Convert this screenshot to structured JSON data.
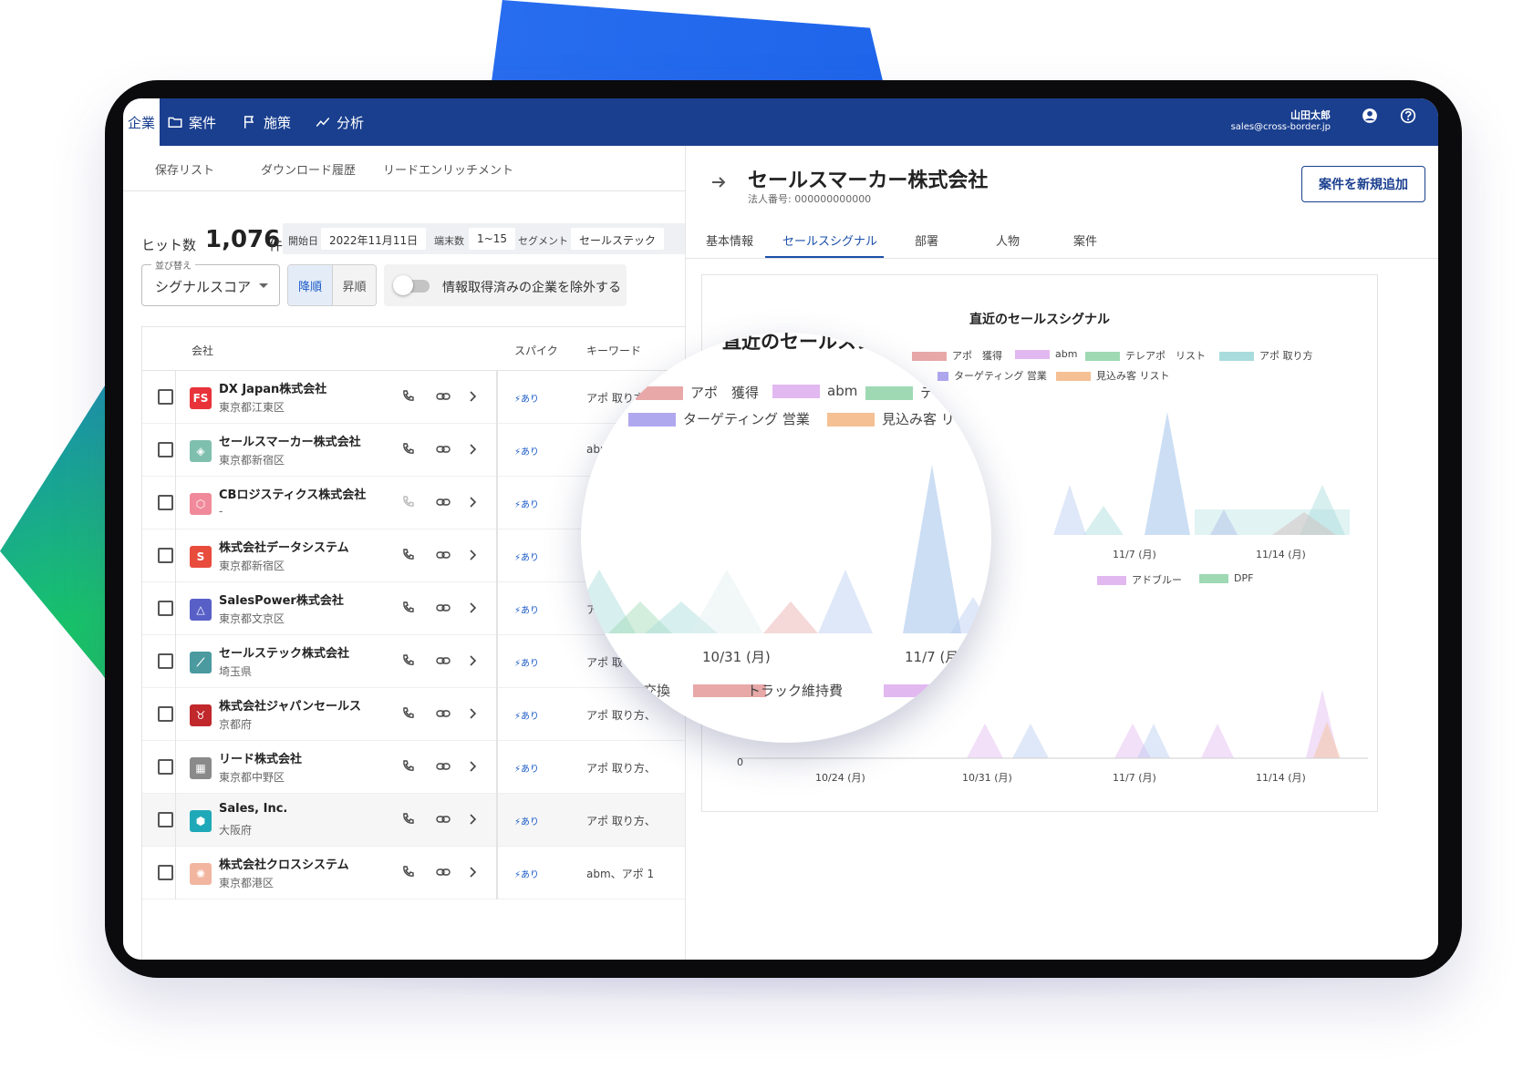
{
  "nav": {
    "items": [
      {
        "label": "企業",
        "icon": "building-icon",
        "active": true
      },
      {
        "label": "案件",
        "icon": "folder-icon",
        "active": false
      },
      {
        "label": "施策",
        "icon": "flag-icon",
        "active": false
      },
      {
        "label": "分析",
        "icon": "analytics-icon",
        "active": false
      }
    ],
    "user_name": "山田太郎",
    "user_email": "sales@cross-border.jp"
  },
  "subtabs": [
    "保存リスト",
    "ダウンロード履歴",
    "リードエンリッチメント"
  ],
  "results": {
    "label": "ヒット数",
    "count": "1,076",
    "unit": "件"
  },
  "filters": {
    "start_label": "開始日",
    "start_value": "2022年11月11日",
    "terminals_label": "端末数",
    "terminals_value": "1~15",
    "segment_label": "セグメント",
    "segment_value": "セールステック"
  },
  "sort": {
    "legend": "並び替え",
    "value": "シグナルスコア",
    "desc_label": "降順",
    "asc_label": "昇順",
    "exclude_label": "情報取得済みの企業を除外する"
  },
  "table": {
    "headers": {
      "company": "会社",
      "spike": "スパイク",
      "keyword": "キーワード"
    },
    "rows": [
      {
        "name": "DX Japan株式会社",
        "address": "東京都江東区",
        "spike": "あり",
        "keyword": "アポ 取り方",
        "logo_text": "FS",
        "logo_color": "#e8333a"
      },
      {
        "name": "セールスマーカー株式会社",
        "address": "東京都新宿区",
        "spike": "あり",
        "keyword": "abm",
        "logo_text": "◈",
        "logo_color": "#7fbfae"
      },
      {
        "name": "CBロジスティクス株式会社",
        "address": "-",
        "spike": "あり",
        "keyword": "",
        "logo_text": "⬡",
        "logo_color": "#f08a9a"
      },
      {
        "name": "株式会社データシステム",
        "address": "東京都新宿区",
        "spike": "あり",
        "keyword": "",
        "logo_text": "S",
        "logo_color": "#e84c3d"
      },
      {
        "name": "SalesPower株式会社",
        "address": "東京都文京区",
        "spike": "あり",
        "keyword": "ア",
        "logo_text": "△",
        "logo_color": "#5860c8"
      },
      {
        "name": "セールステック株式会社",
        "address": "埼玉県",
        "spike": "あり",
        "keyword": "アポ 取",
        "logo_text": "⟋",
        "logo_color": "#4a9aa0"
      },
      {
        "name": "株式会社ジャパンセールス",
        "address": "京都府",
        "spike": "あり",
        "keyword": "アポ 取り方、",
        "logo_text": "♉",
        "logo_color": "#c0282c"
      },
      {
        "name": "リード株式会社",
        "address": "東京都中野区",
        "spike": "あり",
        "keyword": "アポ 取り方、",
        "logo_text": "▦",
        "logo_color": "#8a8a8a"
      },
      {
        "name": "Sales, Inc.",
        "address": "大阪府",
        "spike": "あり",
        "keyword": "アポ 取り方、",
        "logo_text": "⬢",
        "logo_color": "#1fa9b8"
      },
      {
        "name": "株式会社クロスシステム",
        "address": "東京都港区",
        "spike": "あり",
        "keyword": "abm、アポ 1",
        "logo_text": "✺",
        "logo_color": "#f2b6a0"
      }
    ]
  },
  "detail": {
    "company": "セールスマーカー株式会社",
    "corp_number": "法人番号: 000000000000",
    "add_button": "案件を新規追加",
    "tabs": [
      "基本情報",
      "セールスシグナル",
      "部署",
      "人物",
      "案件"
    ],
    "active_tab": "セールスシグナル"
  },
  "chart_data": [
    {
      "type": "area",
      "title": "直近のセールスシグナル",
      "x": [
        "10/24 (月)",
        "10/31 (月)",
        "11/7 (月)",
        "11/14 (月)"
      ],
      "series": [
        {
          "name": "アポ　獲得",
          "color": "#e8a8a8"
        },
        {
          "name": "abm",
          "color": "#e2b8f0"
        },
        {
          "name": "テレアポ　リスト",
          "color": "#9ed9b4"
        },
        {
          "name": "アポ 取り方",
          "color": "#a9dcdc"
        },
        {
          "name": "ターゲティング 営業",
          "color": "#b0a8ee"
        },
        {
          "name": "見込み客 リスト",
          "color": "#f4c094"
        }
      ]
    },
    {
      "type": "area",
      "x": [
        "10/24 (月)",
        "10/31 (月)",
        "11/7 (月)",
        "11/14 (月)"
      ],
      "ylim_min": 0,
      "series": [
        {
          "name": "トラック維持費",
          "color": "#e8a8a8"
        },
        {
          "name": "アドブルー",
          "color": "#e2b8f0"
        },
        {
          "name": "DPF",
          "color": "#9ed9b4"
        }
      ]
    }
  ],
  "magnifier": {
    "partial_title": "直近のセールスシ",
    "legend_row1": [
      "アポ　獲得",
      "abm",
      "テ"
    ],
    "legend_row2": [
      "ターゲティング 営業",
      "見込み客 リ"
    ],
    "x_labels": [
      "10/31 (月)",
      "11/7 (月)"
    ],
    "lower_legend": [
      "交換",
      "トラック維持費"
    ]
  }
}
